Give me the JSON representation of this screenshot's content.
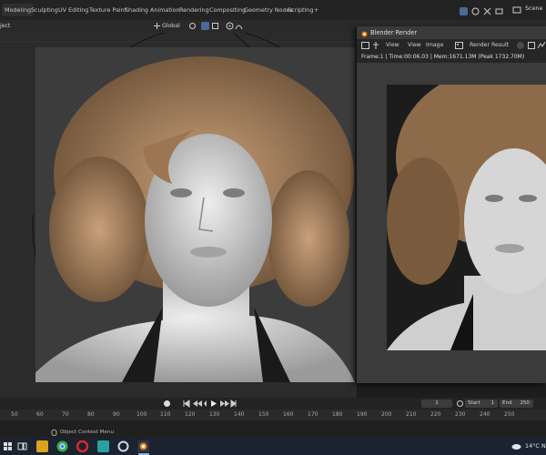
{
  "workspace_tabs": [
    "Modeling",
    "Sculpting",
    "UV Editing",
    "Texture Paint",
    "Shading",
    "Animation",
    "Rendering",
    "Compositing",
    "Geometry Nodes",
    "Scripting"
  ],
  "add_tab": "+",
  "scene_label": "Scene",
  "header": {
    "mode_fragment": "ject",
    "orientation": "Global"
  },
  "render_window": {
    "title": "Blender Render",
    "menu": [
      "View",
      "View",
      "Image"
    ],
    "slot_label": "Render Result",
    "info": "Frame:1 | Time:00:06.03 | Mem:1671.13M (Peak 1732.70M)"
  },
  "timeline": {
    "current_frame": "1",
    "start_label": "Start",
    "start_value": "1",
    "end_label": "End",
    "end_value": "250",
    "ruler_ticks": [
      "50",
      "60",
      "70",
      "80",
      "90",
      "100",
      "110",
      "120",
      "130",
      "140",
      "150",
      "160",
      "170",
      "180",
      "190",
      "200",
      "210",
      "220",
      "230",
      "240",
      "250"
    ]
  },
  "status": {
    "context_menu": "Object Context Menu"
  },
  "taskbar": {
    "temperature": "14°C",
    "extra": "N"
  },
  "colors": {
    "accent": "#e87d0d",
    "hair": "#b08866",
    "skin": "#d9d9d9",
    "taskbar": "#1b2330"
  }
}
